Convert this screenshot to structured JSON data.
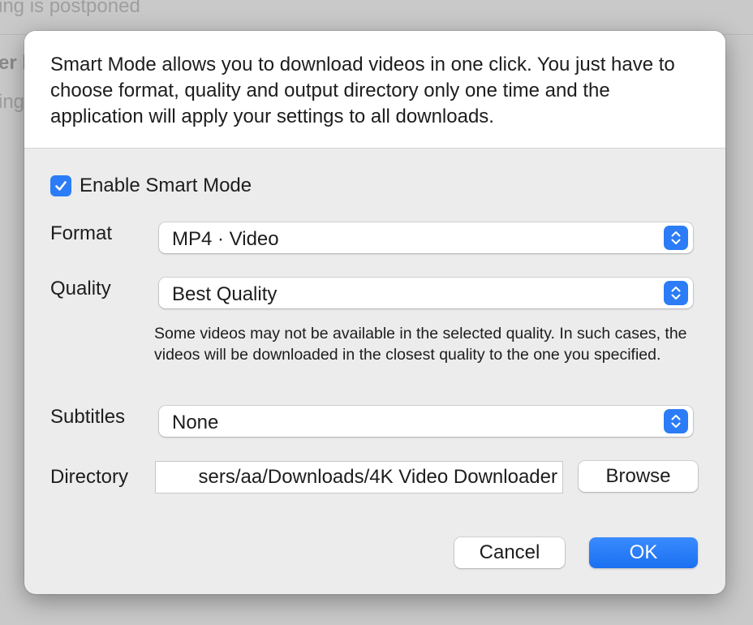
{
  "background": {
    "line1": "ing is postponed",
    "line2": "er l",
    "line3": "ing"
  },
  "dialog": {
    "intro": "Smart Mode allows you to download videos in one click. You just have to choose format, quality and output directory only one time and the application will apply your settings to all downloads.",
    "enable_smart_mode": {
      "label": "Enable Smart Mode",
      "checked": true
    },
    "format": {
      "label": "Format",
      "value": "MP4 · Video"
    },
    "quality": {
      "label": "Quality",
      "value": "Best Quality",
      "note": "Some videos may not be available in the selected quality. In such cases, the videos will be downloaded in the closest quality to the one you specified."
    },
    "subtitles": {
      "label": "Subtitles",
      "value": "None"
    },
    "directory": {
      "label": "Directory",
      "value": "sers/aa/Downloads/4K Video Downloader",
      "browse_label": "Browse"
    },
    "cancel_label": "Cancel",
    "ok_label": "OK"
  },
  "colors": {
    "accent": "#2b7cf6",
    "dialog_bg": "#ececec",
    "header_bg": "#ffffff"
  },
  "icons": {
    "checkbox": "checkmark-icon",
    "stepper": "chevron-up-down-icon"
  }
}
